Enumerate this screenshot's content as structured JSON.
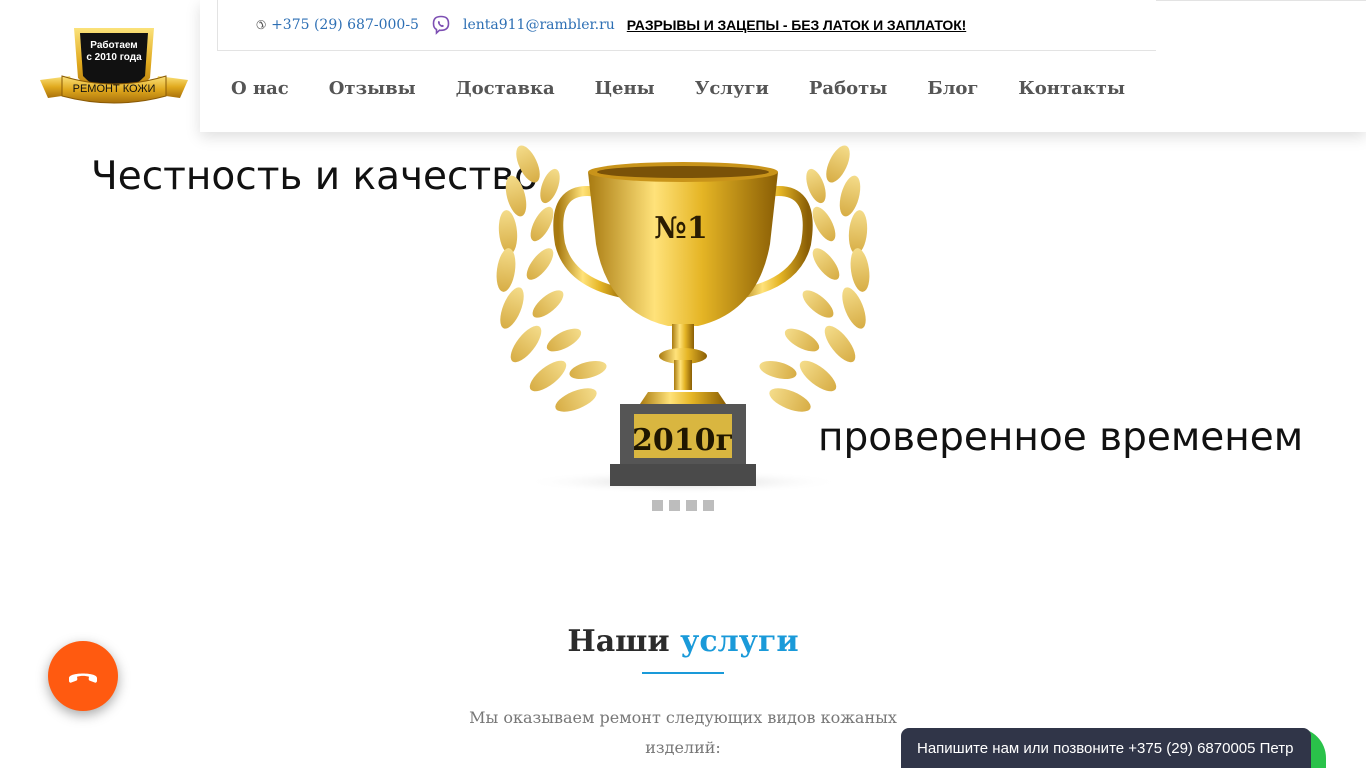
{
  "logo": {
    "line1": "Работаем",
    "line2": "с 2010 года",
    "banner": "РЕМОНТ КОЖИ"
  },
  "topbar": {
    "phone": "+375 (29) 687-000-5",
    "email": "lenta911@rambler.ru",
    "promo": "РАЗРЫВЫ И ЗАЦЕПЫ - БЕЗ ЛАТОК И ЗАПЛАТОК!"
  },
  "nav": {
    "items": [
      {
        "label": "О нас"
      },
      {
        "label": "Отзывы"
      },
      {
        "label": "Доставка"
      },
      {
        "label": "Цены"
      },
      {
        "label": "Услуги"
      },
      {
        "label": "Работы"
      },
      {
        "label": "Блог"
      },
      {
        "label": "Контакты"
      }
    ]
  },
  "hero": {
    "title_part1": "Честность и качество",
    "title_part2": "проверенное временем",
    "trophy_cup_text": "№1",
    "trophy_plate_text": "2010г",
    "slide_count": 4
  },
  "services": {
    "title_plain": "Наши",
    "title_accent": "услуги",
    "description": "Мы оказываем ремонт следующих видов кожаных изделий:"
  },
  "chat": {
    "text": "Напишите нам или позвоните +375 (29) 6870005 Петр"
  },
  "icons": {
    "phone": "phone-icon",
    "viber": "viber-icon",
    "call": "handset-icon"
  },
  "colors": {
    "accent": "#1a9ad9",
    "link": "#2d6fb4",
    "call_button": "#ff5a10",
    "chat_bar": "#303548",
    "chat_green": "#2ac24a",
    "viber": "#7d4fb3"
  }
}
